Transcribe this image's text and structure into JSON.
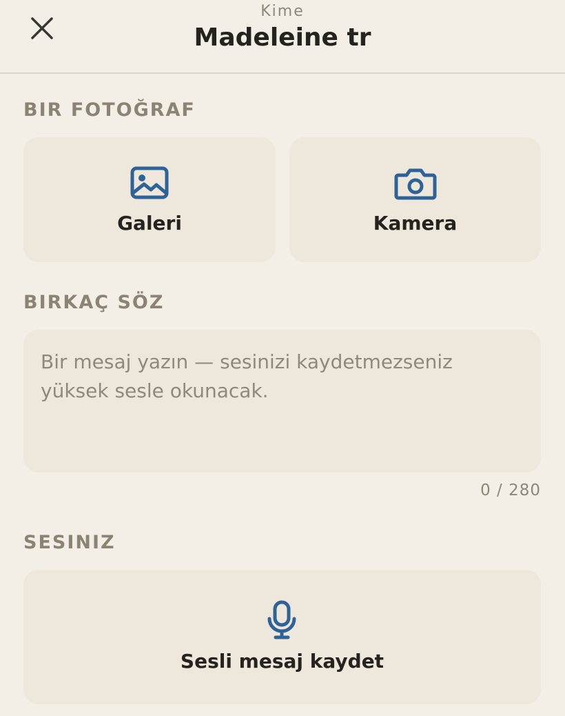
{
  "header": {
    "caption": "Kime",
    "recipient": "Madeleine tr",
    "close_icon": "close-icon"
  },
  "photo_section": {
    "label": "BIR FOTOĞRAF",
    "gallery": {
      "label": "Galeri",
      "icon": "image-icon"
    },
    "camera": {
      "label": "Kamera",
      "icon": "camera-icon"
    }
  },
  "message_section": {
    "label": "BIRKAÇ SÖZ",
    "placeholder": "Bir mesaj yazın — sesinizi kaydetmezseniz yüksek sesle okunacak.",
    "value": "",
    "counter": "0 / 280"
  },
  "voice_section": {
    "label": "SESINIZ",
    "record": {
      "label": "Sesli mesaj kaydet",
      "icon": "microphone-icon"
    }
  },
  "colors": {
    "background": "#f3efe6",
    "card": "#ede7dc",
    "accent": "#2f6398",
    "text": "#26231f",
    "muted": "#8b8374"
  }
}
